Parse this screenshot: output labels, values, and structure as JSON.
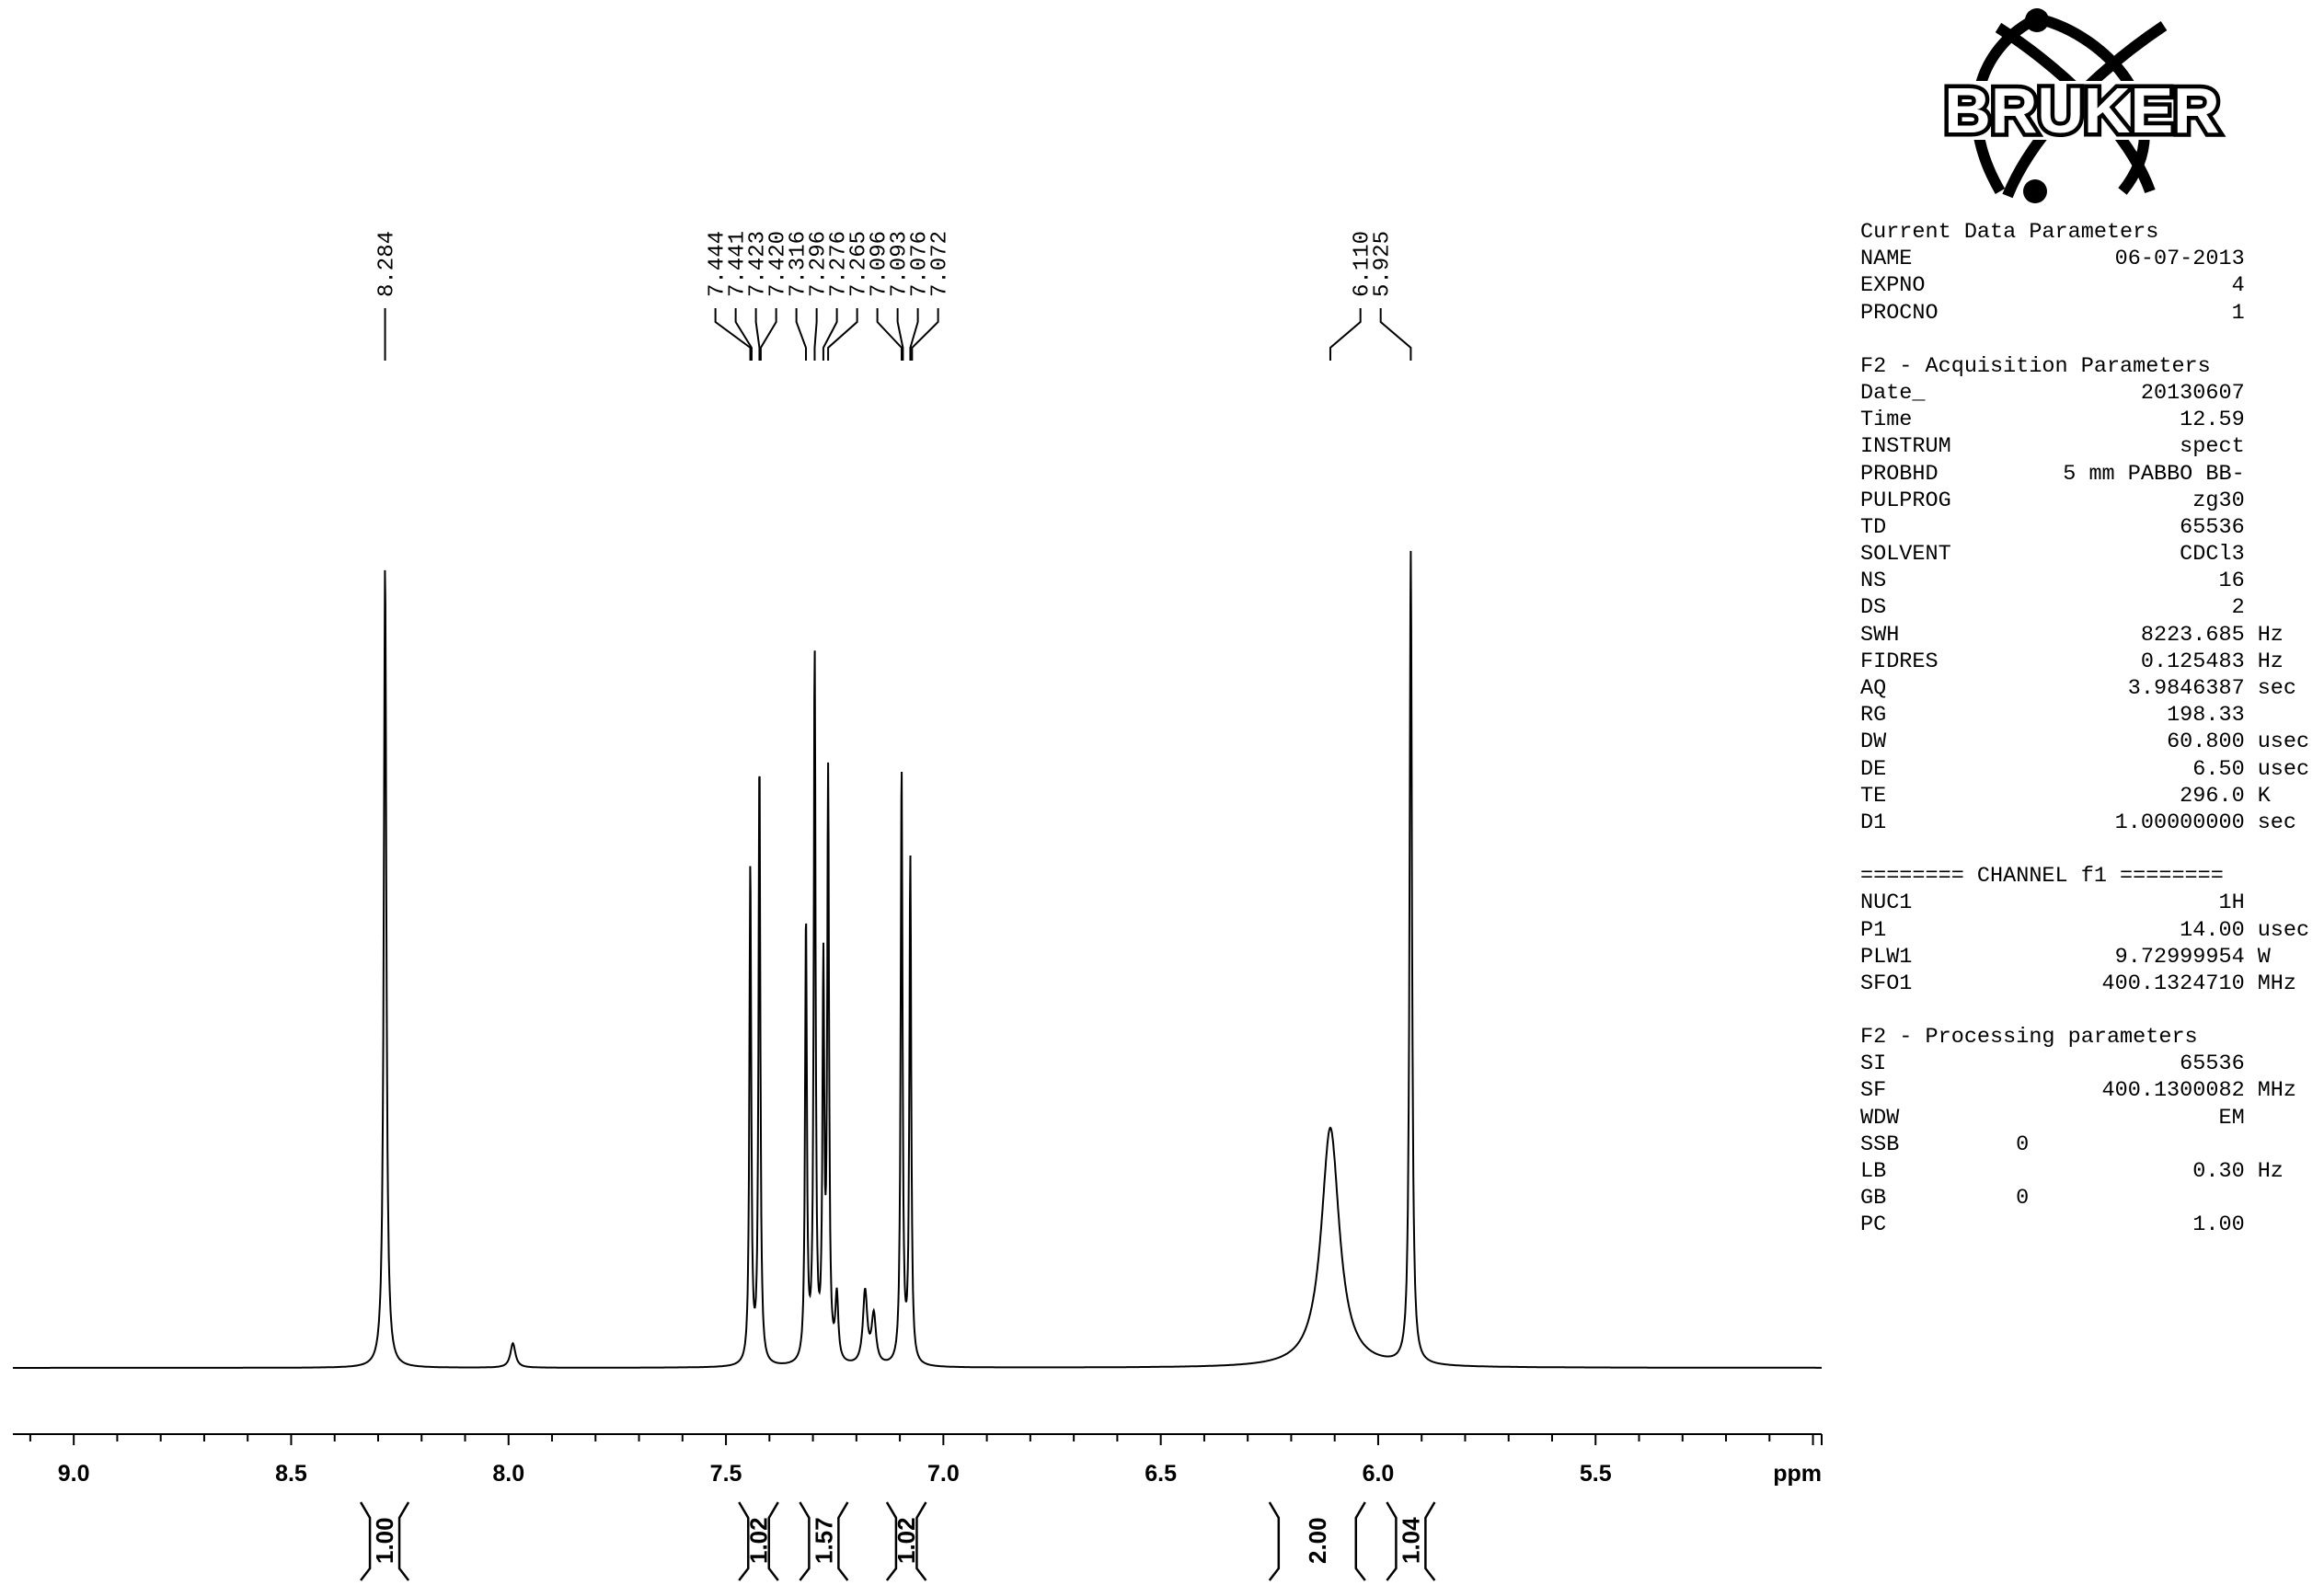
{
  "logo": {
    "text": "BRUKER"
  },
  "chart_data": {
    "type": "line",
    "title": "",
    "xlabel": "ppm",
    "ylabel": "",
    "xlim": [
      9.14,
      4.98
    ],
    "x_reversed": true,
    "grid": false,
    "tick_labels": [
      "9.0",
      "8.5",
      "8.0",
      "7.5",
      "7.0",
      "6.5",
      "6.0",
      "5.5"
    ],
    "tick_values": [
      9.0,
      8.5,
      8.0,
      7.5,
      7.0,
      6.5,
      6.0,
      5.5
    ],
    "unit_label": "ppm",
    "peaks": [
      {
        "ppm": 8.284,
        "height": 0.985,
        "width": 0.0035
      },
      {
        "ppm": 7.99,
        "height": 0.03,
        "width": 0.007
      },
      {
        "ppm": 7.444,
        "height": 0.615,
        "width": 0.0025
      },
      {
        "ppm": 7.423,
        "height": 0.745,
        "width": 0.0025
      },
      {
        "ppm": 7.316,
        "height": 0.545,
        "width": 0.0025
      },
      {
        "ppm": 7.296,
        "height": 0.87,
        "width": 0.0025
      },
      {
        "ppm": 7.276,
        "height": 0.47,
        "width": 0.0025
      },
      {
        "ppm": 7.265,
        "height": 0.71,
        "width": 0.0025
      },
      {
        "ppm": 7.245,
        "height": 0.08,
        "width": 0.004
      },
      {
        "ppm": 7.18,
        "height": 0.09,
        "width": 0.006
      },
      {
        "ppm": 7.16,
        "height": 0.06,
        "width": 0.006
      },
      {
        "ppm": 7.096,
        "height": 0.735,
        "width": 0.0025
      },
      {
        "ppm": 7.076,
        "height": 0.62,
        "width": 0.0025
      },
      {
        "ppm": 6.11,
        "height": 0.295,
        "width": 0.025
      },
      {
        "ppm": 5.925,
        "height": 1.0,
        "width": 0.0033
      }
    ],
    "peak_labels": [
      {
        "text": "8.284",
        "ppm": 8.284
      },
      {
        "text": "7.444",
        "ppm": 7.444
      },
      {
        "text": "7.441",
        "ppm": 7.441
      },
      {
        "text": "7.423",
        "ppm": 7.423
      },
      {
        "text": "7.420",
        "ppm": 7.42
      },
      {
        "text": "7.316",
        "ppm": 7.316
      },
      {
        "text": "7.296",
        "ppm": 7.296
      },
      {
        "text": "7.276",
        "ppm": 7.276
      },
      {
        "text": "7.265",
        "ppm": 7.265
      },
      {
        "text": "7.096",
        "ppm": 7.096
      },
      {
        "text": "7.093",
        "ppm": 7.093
      },
      {
        "text": "7.076",
        "ppm": 7.076
      },
      {
        "text": "7.072",
        "ppm": 7.072
      },
      {
        "text": "6.110",
        "ppm": 6.11
      },
      {
        "text": "5.925",
        "ppm": 5.925
      }
    ],
    "integrals": [
      {
        "value": "1.00",
        "start": 8.34,
        "end": 8.23
      },
      {
        "value": "1.02",
        "start": 7.47,
        "end": 7.38
      },
      {
        "value": "1.57",
        "start": 7.33,
        "end": 7.22
      },
      {
        "value": "1.02",
        "start": 7.13,
        "end": 7.04
      },
      {
        "value": "2.00",
        "start": 6.25,
        "end": 6.03
      },
      {
        "value": "1.04",
        "start": 5.98,
        "end": 5.87
      }
    ]
  },
  "parameters": {
    "sections": [
      {
        "header": "Current Data Parameters",
        "rows": [
          {
            "name": "NAME",
            "value": "06-07-2013",
            "unit": ""
          },
          {
            "name": "EXPNO",
            "value": "4",
            "unit": ""
          },
          {
            "name": "PROCNO",
            "value": "1",
            "unit": ""
          }
        ]
      },
      {
        "header": "F2 - Acquisition Parameters",
        "rows": [
          {
            "name": "Date_",
            "value": "20130607",
            "unit": ""
          },
          {
            "name": "Time",
            "value": "12.59",
            "unit": ""
          },
          {
            "name": "INSTRUM",
            "value": "spect",
            "unit": ""
          },
          {
            "name": "PROBHD",
            "value": "5 mm PABBO BB-",
            "unit": ""
          },
          {
            "name": "PULPROG",
            "value": "zg30",
            "unit": ""
          },
          {
            "name": "TD",
            "value": "65536",
            "unit": ""
          },
          {
            "name": "SOLVENT",
            "value": "CDCl3",
            "unit": ""
          },
          {
            "name": "NS",
            "value": "16",
            "unit": ""
          },
          {
            "name": "DS",
            "value": "2",
            "unit": ""
          },
          {
            "name": "SWH",
            "value": "8223.685",
            "unit": "Hz"
          },
          {
            "name": "FIDRES",
            "value": "0.125483",
            "unit": "Hz"
          },
          {
            "name": "AQ",
            "value": "3.9846387",
            "unit": "sec"
          },
          {
            "name": "RG",
            "value": "198.33",
            "unit": ""
          },
          {
            "name": "DW",
            "value": "60.800",
            "unit": "usec"
          },
          {
            "name": "DE",
            "value": "6.50",
            "unit": "usec"
          },
          {
            "name": "TE",
            "value": "296.0",
            "unit": "K"
          },
          {
            "name": "D1",
            "value": "1.00000000",
            "unit": "sec"
          }
        ]
      },
      {
        "header": "======== CHANNEL f1 ========",
        "rows": [
          {
            "name": "NUC1",
            "value": "1H",
            "unit": ""
          },
          {
            "name": "P1",
            "value": "14.00",
            "unit": "usec"
          },
          {
            "name": "PLW1",
            "value": "9.72999954",
            "unit": "W"
          },
          {
            "name": "SFO1",
            "value": "400.1324710",
            "unit": "MHz"
          }
        ]
      },
      {
        "header": "F2 - Processing parameters",
        "rows": [
          {
            "name": "SI",
            "value": "65536",
            "unit": ""
          },
          {
            "name": "SF",
            "value": "400.1300082",
            "unit": "MHz"
          },
          {
            "name": "WDW",
            "value": "EM",
            "unit": ""
          },
          {
            "name": "SSB",
            "value": "0",
            "unit": "",
            "left": true
          },
          {
            "name": "LB",
            "value": "0.30",
            "unit": "Hz"
          },
          {
            "name": "GB",
            "value": "0",
            "unit": "",
            "left": true
          },
          {
            "name": "PC",
            "value": "1.00",
            "unit": ""
          }
        ]
      }
    ]
  }
}
